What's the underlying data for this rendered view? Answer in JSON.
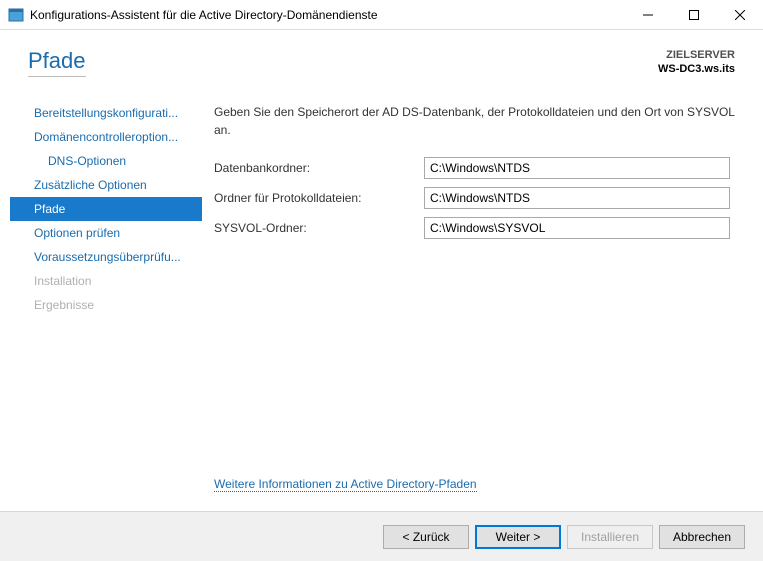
{
  "window": {
    "title": "Konfigurations-Assistent für die Active Directory-Domänendienste"
  },
  "header": {
    "page_title": "Pfade",
    "target_label": "ZIELSERVER",
    "target_value": "WS-DC3.ws.its"
  },
  "sidebar": {
    "items": [
      {
        "label": "Bereitstellungskonfigurati...",
        "sub": false,
        "selected": false,
        "disabled": false
      },
      {
        "label": "Domänencontrolleroption...",
        "sub": false,
        "selected": false,
        "disabled": false
      },
      {
        "label": "DNS-Optionen",
        "sub": true,
        "selected": false,
        "disabled": false
      },
      {
        "label": "Zusätzliche Optionen",
        "sub": false,
        "selected": false,
        "disabled": false
      },
      {
        "label": "Pfade",
        "sub": false,
        "selected": true,
        "disabled": false
      },
      {
        "label": "Optionen prüfen",
        "sub": false,
        "selected": false,
        "disabled": false
      },
      {
        "label": "Voraussetzungsüberprüfu...",
        "sub": false,
        "selected": false,
        "disabled": false
      },
      {
        "label": "Installation",
        "sub": false,
        "selected": false,
        "disabled": true
      },
      {
        "label": "Ergebnisse",
        "sub": false,
        "selected": false,
        "disabled": true
      }
    ]
  },
  "content": {
    "intro": "Geben Sie den Speicherort der AD DS-Datenbank, der Protokolldateien und den Ort von SYSVOL an.",
    "rows": [
      {
        "label": "Datenbankordner:",
        "value": "C:\\Windows\\NTDS"
      },
      {
        "label": "Ordner für Protokolldateien:",
        "value": "C:\\Windows\\NTDS"
      },
      {
        "label": "SYSVOL-Ordner:",
        "value": "C:\\Windows\\SYSVOL"
      }
    ],
    "more_info_link": "Weitere Informationen zu Active Directory-Pfaden"
  },
  "footer": {
    "back": "< Zurück",
    "next": "Weiter >",
    "install": "Installieren",
    "cancel": "Abbrechen",
    "install_enabled": false
  }
}
